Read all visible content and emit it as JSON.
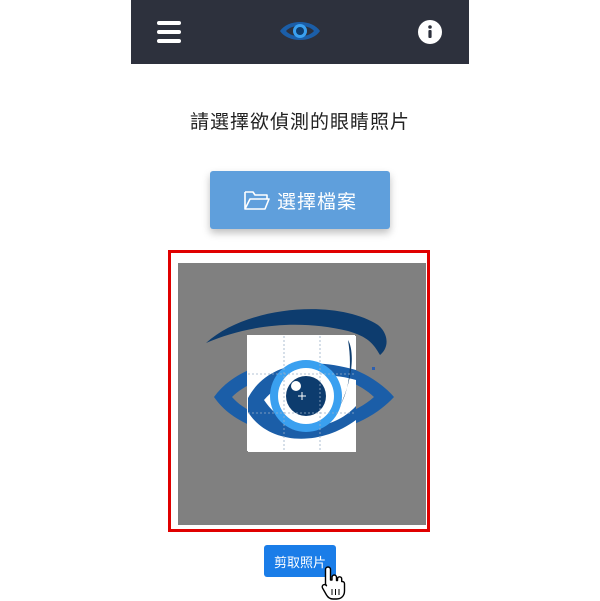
{
  "header": {
    "menu_icon": "hamburger-menu-icon",
    "logo_icon": "eye-logo-icon",
    "info_icon": "info-icon"
  },
  "main": {
    "prompt": "請選擇欲偵測的眼睛照片",
    "choose_file_label": "選擇檔案",
    "crop_button_label": "剪取照片"
  },
  "colors": {
    "topbar": "#2d313d",
    "choose_button": "#5f9fdc",
    "crop_button": "#1a7de8",
    "frame_border": "#e00000",
    "eye_dark": "#0d3c6e",
    "eye_light": "#3aa0f0"
  }
}
